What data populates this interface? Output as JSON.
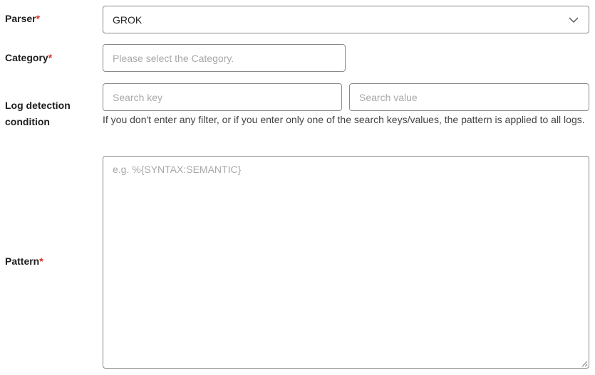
{
  "form": {
    "parser": {
      "label": "Parser",
      "required_mark": "*",
      "selected_value": "GROK",
      "icon": "chevron-down-icon"
    },
    "category": {
      "label": "Category",
      "required_mark": "*",
      "placeholder": "Please select the Category."
    },
    "log_detection": {
      "label_line1": "Log detection",
      "label_line2": "condition",
      "search_key_placeholder": "Search key",
      "search_value_placeholder": "Search value",
      "help_text": "If you don't enter any filter, or if you enter only one of the search keys/values, the pattern is applied to all logs."
    },
    "pattern": {
      "label": "Pattern",
      "required_mark": "*",
      "placeholder": "e.g. %{SYNTAX:SEMANTIC}",
      "value": ""
    }
  },
  "colors": {
    "required": "#d93025",
    "border": "#8a8a8a",
    "placeholder": "#a8a8a8"
  }
}
